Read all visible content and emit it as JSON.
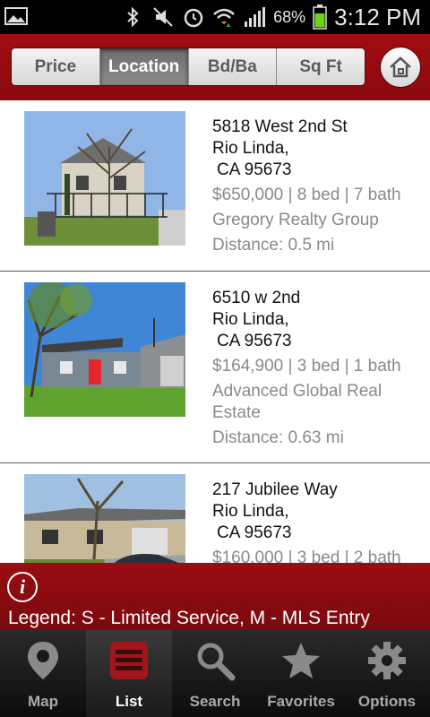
{
  "status_bar": {
    "battery_percent": "68%",
    "time": "3:12 PM"
  },
  "sort_toolbar": {
    "options": [
      "Price",
      "Location",
      "Bd/Ba",
      "Sq Ft"
    ],
    "selected": "Location"
  },
  "listings": [
    {
      "street": "5818 West 2nd St",
      "city": "Rio Linda,",
      "state_zip": "CA 95673",
      "price_beds_baths": "$650,000 | 8 bed | 7 bath",
      "broker": "Gregory Realty Group",
      "distance": "Distance: 0.5 mi"
    },
    {
      "street": "6510 w 2nd",
      "city": "Rio Linda,",
      "state_zip": "CA 95673",
      "price_beds_baths": "$164,900 | 3 bed | 1 bath",
      "broker": "Advanced Global Real Estate",
      "distance": "Distance: 0.63 mi"
    },
    {
      "street": "217 Jubilee Way",
      "city": "Rio Linda,",
      "state_zip": "CA 95673",
      "price_beds_baths": "$160,000 | 3 bed | 2 bath",
      "broker": "",
      "distance": ""
    }
  ],
  "legend": {
    "text": "Legend: S - Limited Service, M - MLS Entry"
  },
  "tabs": [
    {
      "label": "Map",
      "icon": "map-pin-icon"
    },
    {
      "label": "List",
      "icon": "list-icon"
    },
    {
      "label": "Search",
      "icon": "search-icon"
    },
    {
      "label": "Favorites",
      "icon": "star-icon"
    },
    {
      "label": "Options",
      "icon": "gear-icon"
    }
  ],
  "active_tab": "List",
  "colors": {
    "brand_red": "#9a0c12",
    "meta_gray": "#8a8a8a"
  }
}
